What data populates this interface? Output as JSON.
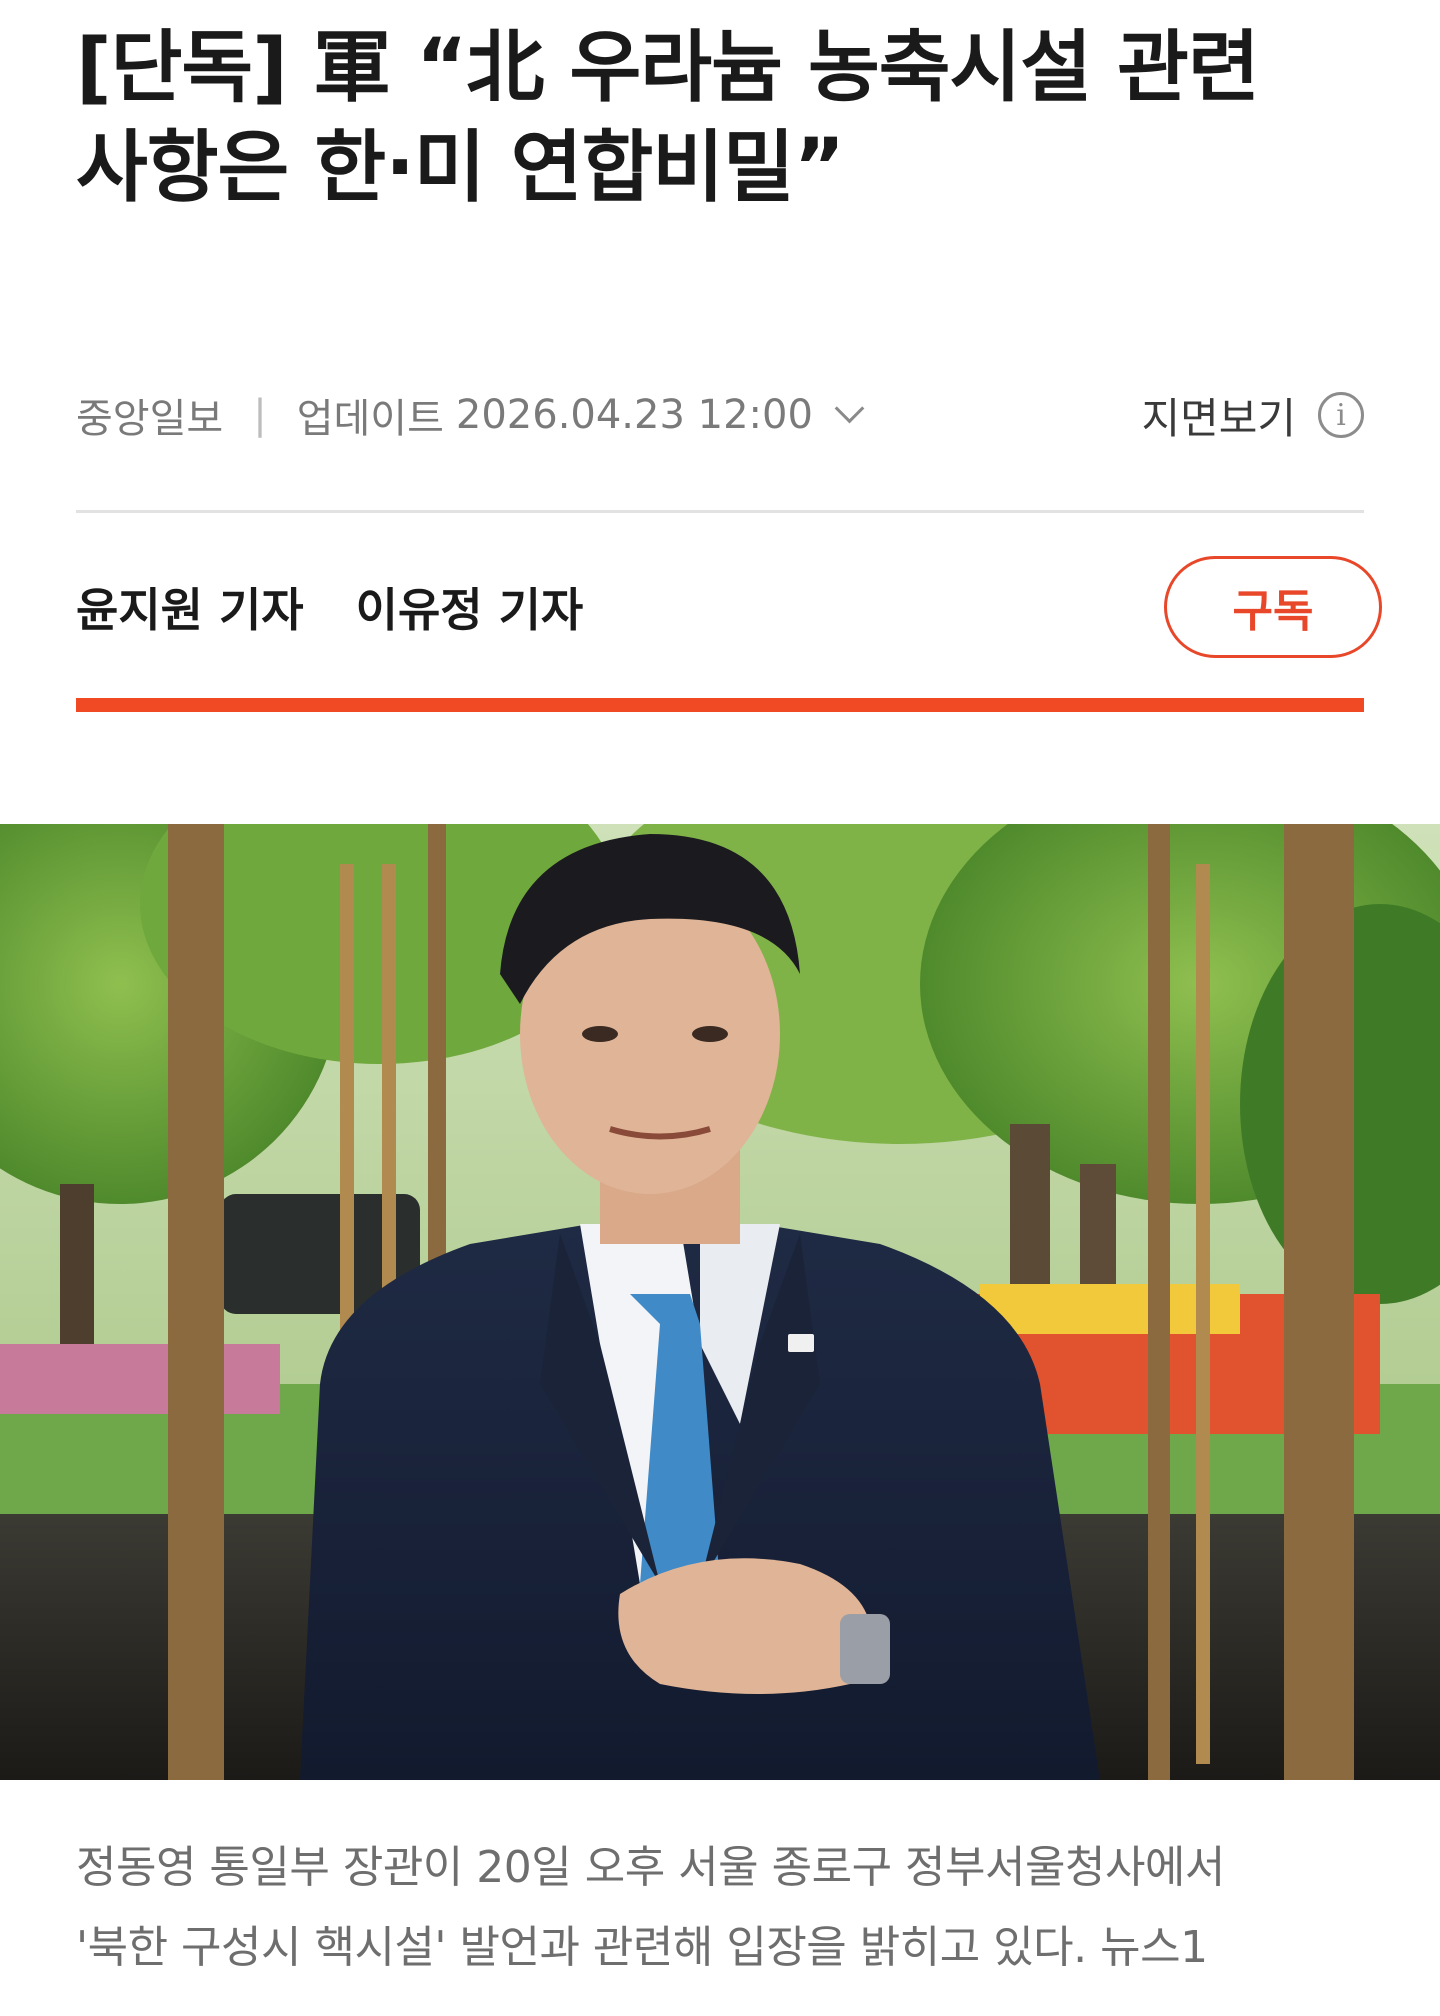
{
  "article": {
    "headline_line1": "[단독] 軍 “北 우라늄 농축시설 관련",
    "headline_line2": "사항은 한·미 연합비밀”",
    "publisher": "중앙일보",
    "separator": "|",
    "update_label": "업데이트",
    "update_datetime": "2026.04.23 12:00",
    "paper_view_label": "지면보기",
    "info_icon_glyph": "i",
    "reporters": [
      "윤지원 기자",
      "이유정 기자"
    ],
    "subscribe_label": "구독",
    "caption_line1": "정동영 통일부 장관이 20일 오후 서울 종로구 정부서울청사에서",
    "caption_line2": "'북한 구성시 핵시설' 발언과 관련해 입장을 밝히고 있다. 뉴스1"
  },
  "colors": {
    "accent": "#f04a25",
    "subscribe": "#e8472a",
    "headline": "#1a1a1a",
    "meta": "#7a7a7a",
    "caption": "#6e6e6e"
  },
  "icons": {
    "chevron": "chevron-down-icon",
    "info": "info-icon"
  }
}
